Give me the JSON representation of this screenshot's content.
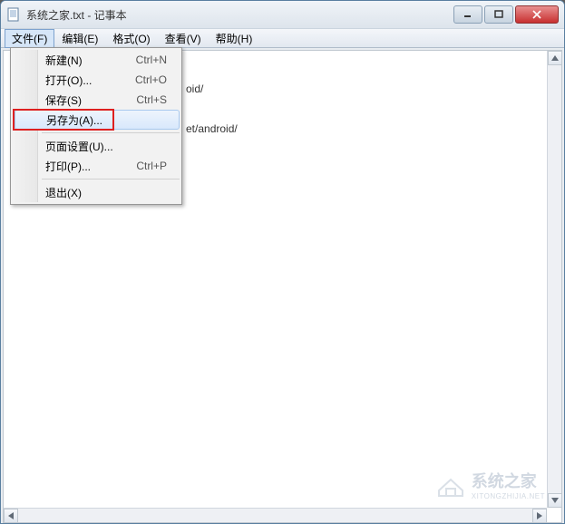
{
  "titlebar": {
    "title": "系统之家.txt - 记事本"
  },
  "menubar": {
    "items": [
      {
        "label": "文件(F)"
      },
      {
        "label": "编辑(E)"
      },
      {
        "label": "格式(O)"
      },
      {
        "label": "查看(V)"
      },
      {
        "label": "帮助(H)"
      }
    ]
  },
  "dropdown": {
    "items": [
      {
        "label": "新建(N)",
        "shortcut": "Ctrl+N"
      },
      {
        "label": "打开(O)...",
        "shortcut": "Ctrl+O"
      },
      {
        "label": "保存(S)",
        "shortcut": "Ctrl+S"
      },
      {
        "label": "另存为(A)...",
        "shortcut": ""
      },
      {
        "label": "页面设置(U)...",
        "shortcut": ""
      },
      {
        "label": "打印(P)...",
        "shortcut": "Ctrl+P"
      },
      {
        "label": "退出(X)",
        "shortcut": ""
      }
    ]
  },
  "editor": {
    "lines": [
      "oid/",
      "et/android/"
    ]
  },
  "watermark": {
    "text": "系统之家",
    "url": "XITONGZHIJIA.NET"
  }
}
